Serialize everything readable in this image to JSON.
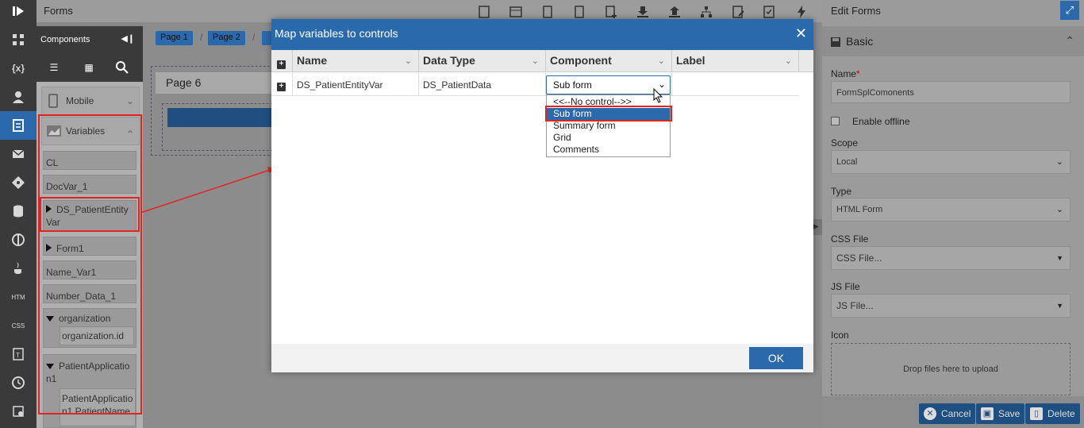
{
  "topbar": {
    "title": "Forms"
  },
  "components": {
    "header": "Components",
    "sections": {
      "mobile": "Mobile",
      "variables": "Variables"
    },
    "variables": [
      "CL",
      "DocVar_1",
      "DS_PatientEntityVar",
      "Form1",
      "Name_Var1",
      "Number_Data_1",
      "organization",
      "organization.id",
      "PatientApplication1",
      "PatientApplication1.PatientName"
    ]
  },
  "canvas": {
    "breadcrumbs": [
      "Page 1",
      "Page 2"
    ],
    "page_title": "Page 6"
  },
  "dialog": {
    "title": "Map variables to controls",
    "columns": [
      "Name",
      "Data Type",
      "Component",
      "Label"
    ],
    "row": {
      "name": "DS_PatientEntityVar",
      "data_type": "DS_PatientData",
      "component": "Sub form",
      "label": ""
    },
    "options": [
      "<<--No control-->>",
      "Sub form",
      "Summary form",
      "Grid",
      "Comments"
    ],
    "ok_label": "OK"
  },
  "edit_forms": {
    "title": "Edit Forms",
    "section": "Basic",
    "name_label": "Name",
    "name_value": "FormSplComonents",
    "offline_label": "Enable offline",
    "scope_label": "Scope",
    "scope_value": "Local",
    "type_label": "Type",
    "type_value": "HTML Form",
    "css_label": "CSS File",
    "css_placeholder": "CSS File...",
    "js_label": "JS File",
    "js_placeholder": "JS File...",
    "icon_label": "Icon",
    "dropzone_text": "Drop files here to upload",
    "cancel_label": "Cancel",
    "save_label": "Save",
    "delete_label": "Delete"
  },
  "colors": {
    "accent": "#2a69ac",
    "highlight_border": "#e32323"
  }
}
